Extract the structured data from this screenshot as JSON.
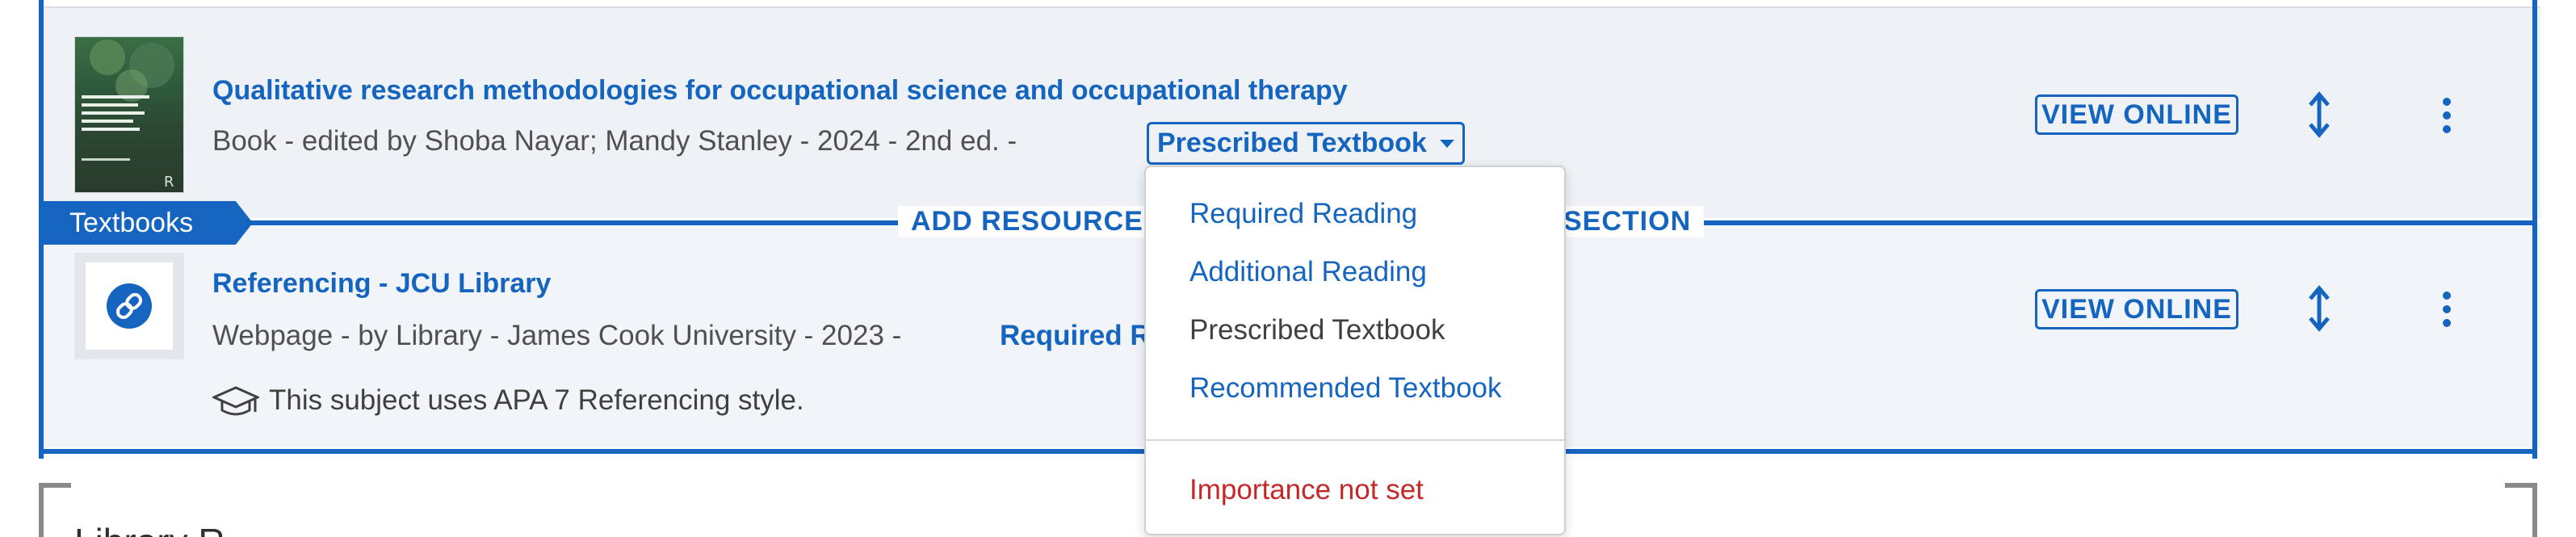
{
  "colors": {
    "accent": "#1565c0",
    "danger": "#c62828",
    "item_bg": "#eef2f7",
    "text_muted": "#505050"
  },
  "items": [
    {
      "title": "Qualitative research methodologies for occupational science and occupational therapy",
      "meta": "Book  -  edited by Shoba Nayar; Mandy Stanley  -  2024  -  2nd ed.  -",
      "importance": "Prescribed Textbook",
      "view_label": "VIEW ONLINE",
      "thumb_icon": "book-cover"
    },
    {
      "title": "Referencing - JCU Library",
      "meta": "Webpage  -  by Library - James Cook University  -  2023  -",
      "importance": "Required R",
      "view_label": "VIEW ONLINE",
      "note": "This subject uses APA 7 Referencing style.",
      "thumb_icon": "link-icon"
    }
  ],
  "section": {
    "tag": "Textbooks",
    "add_resource": "ADD RESOURCE",
    "add_section": "SECTION"
  },
  "dropdown": {
    "options": [
      "Required Reading",
      "Additional Reading",
      "Prescribed Textbook",
      "Recommended Textbook"
    ],
    "selected": "Prescribed Textbook",
    "clear_label": "Importance not set"
  },
  "next_section": {
    "title_partial": "Library R"
  }
}
